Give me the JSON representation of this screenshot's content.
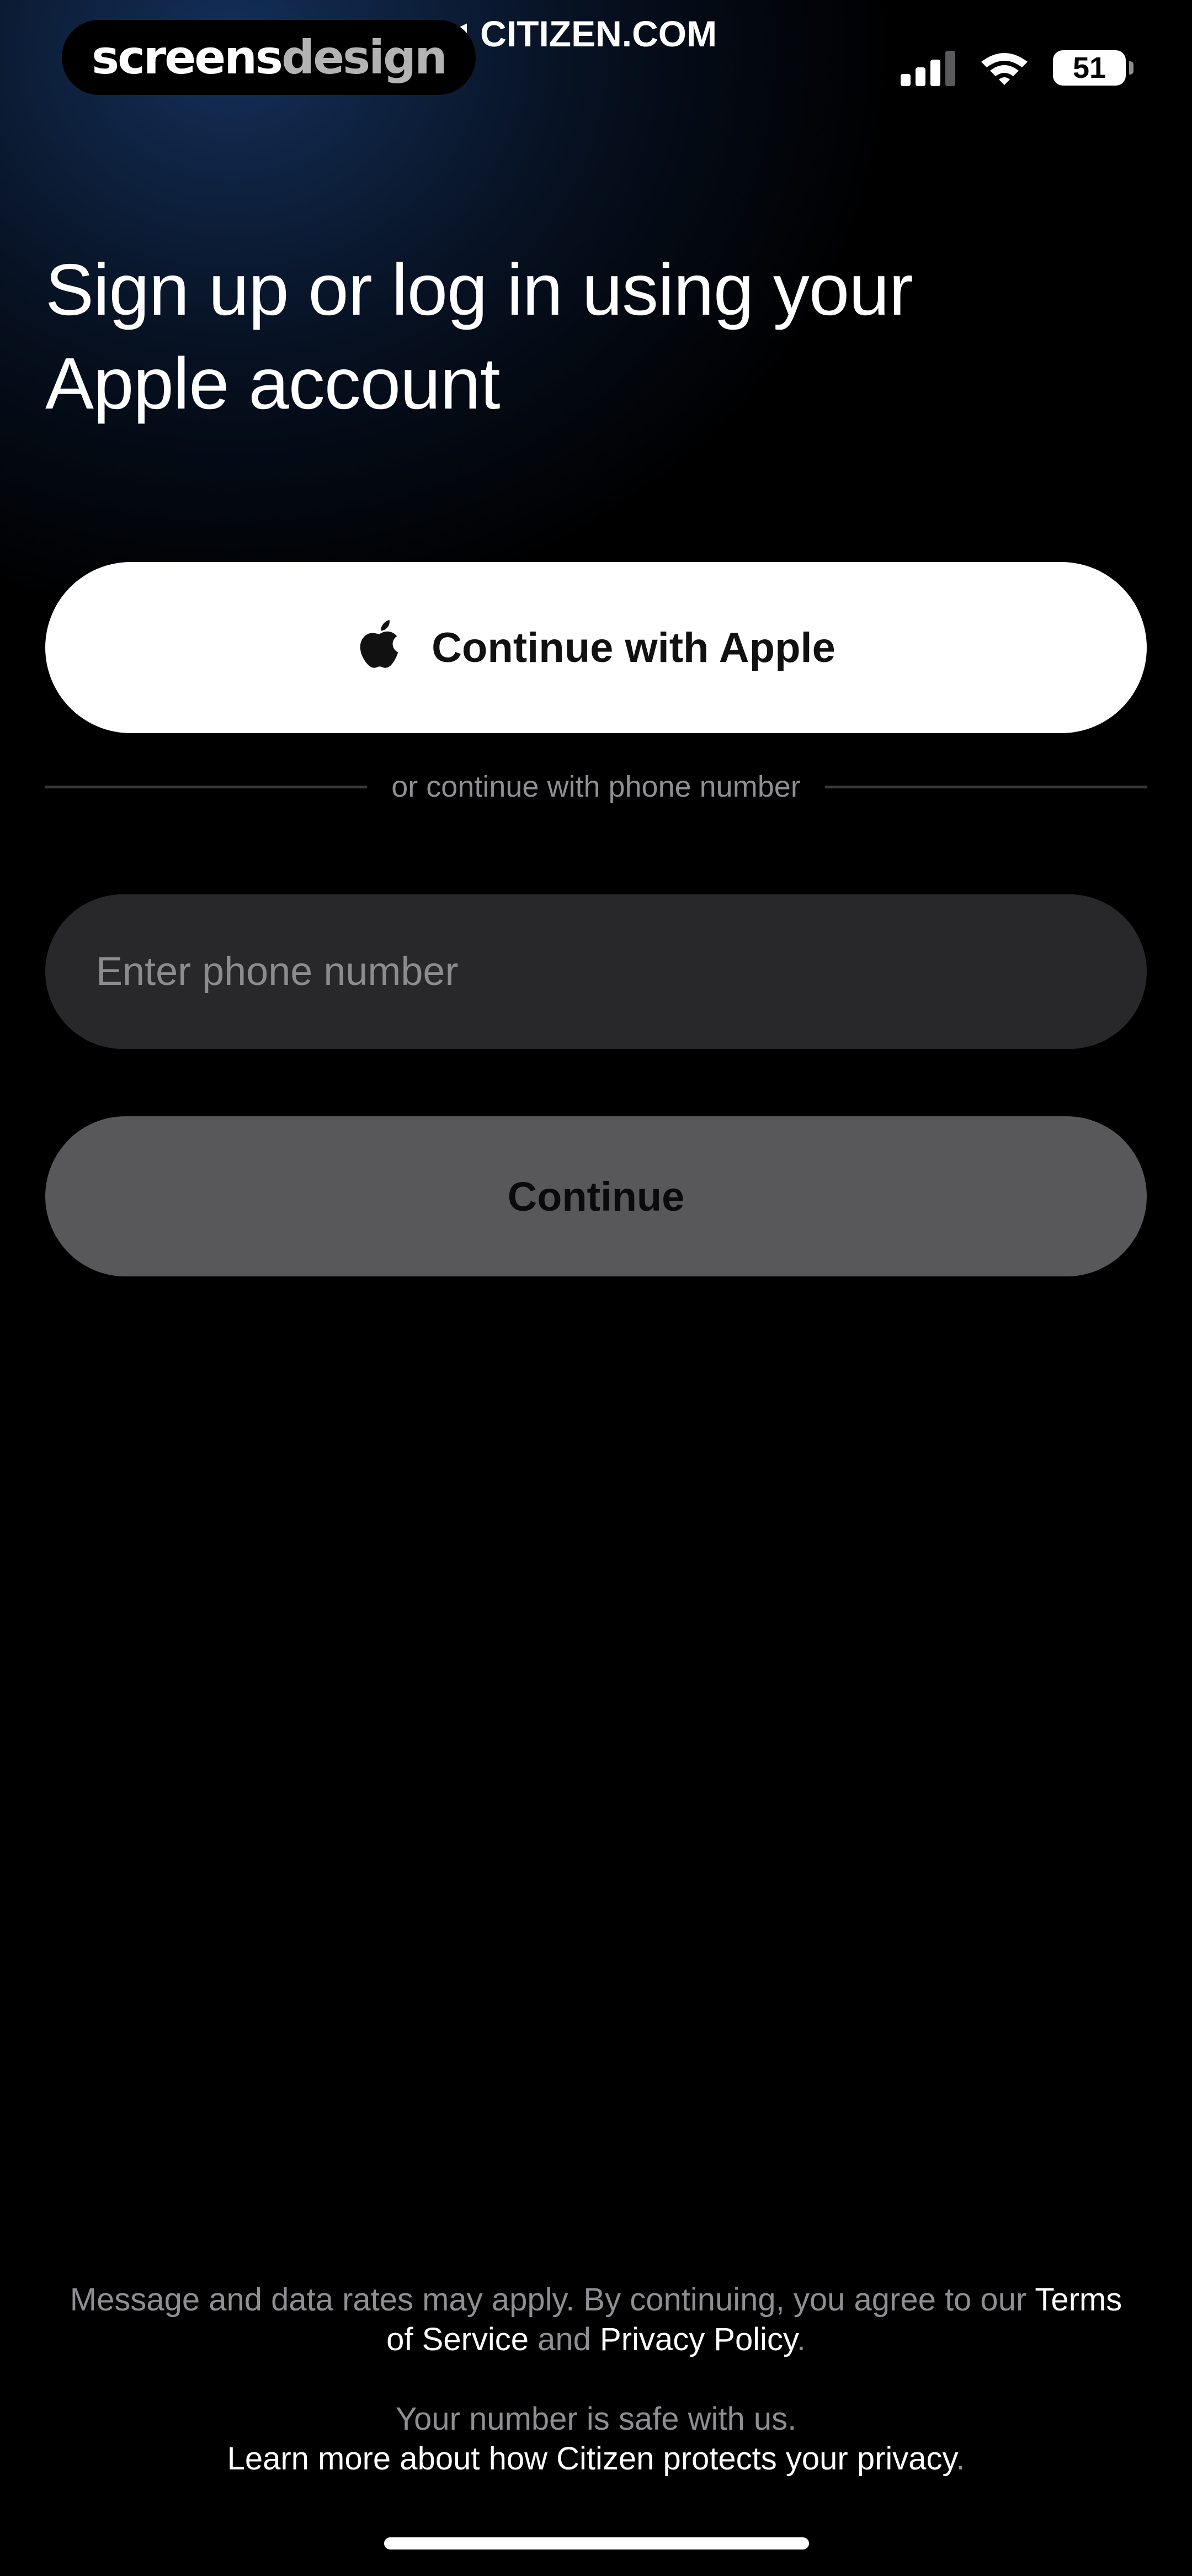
{
  "status_bar": {
    "watermark_primary": "screens",
    "watermark_secondary": "design",
    "back_glyph": "◀",
    "carrier_label": "CITIZEN.COM",
    "battery_level": "51",
    "icons": [
      "cellular-signal-icon",
      "wifi-icon",
      "battery-icon"
    ]
  },
  "auth": {
    "headline": "Sign up or log in using your Apple account",
    "apple_button_label": "Continue with Apple",
    "apple_icon": "apple-logo-icon",
    "divider_text": "or continue with phone number",
    "phone_value": "",
    "phone_placeholder": "Enter phone number",
    "continue_label": "Continue"
  },
  "legal": {
    "line1_text": "Message and data rates may apply. By continuing, you agree to our ",
    "terms_link": "Terms of Service",
    "and_text": " and ",
    "privacy_link": "Privacy Policy",
    "line1_end": ".",
    "safe_text": "Your number is safe with us.",
    "learn_more_link": "Learn more about how Citizen protects your privacy",
    "learn_more_end": "."
  },
  "colors": {
    "background": "#000000",
    "gradient_accent": "#163460",
    "apple_button_bg": "#ffffff",
    "phone_field_bg": "#28282a",
    "continue_button_bg": "#58585a",
    "muted_text": "#8e8e93"
  }
}
